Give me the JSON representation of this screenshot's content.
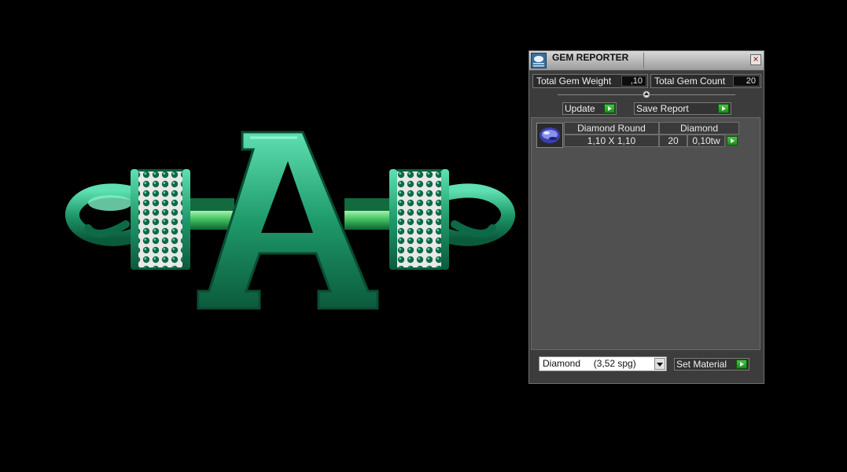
{
  "panel": {
    "title": "GEM REPORTER",
    "close_label": "×",
    "total_weight": {
      "label": "Total Gem Weight",
      "value": ",10"
    },
    "total_count": {
      "label": "Total Gem Count",
      "value": "20"
    },
    "update_label": "Update",
    "save_report_label": "Save Report",
    "gems": [
      {
        "name": "Diamond Round",
        "size": "1,10 X 1,10",
        "material": "Diamond",
        "count": "20",
        "weight": "0,10tw"
      }
    ],
    "material_select": {
      "selected": "Diamond     (3,52 spg)"
    },
    "set_material_label": "Set Material"
  },
  "icons": {
    "app": "gem-reporter-icon",
    "close": "close-icon",
    "collapse": "collapse-arrow-icon",
    "gem": "round-gem-icon"
  },
  "colors": {
    "accent_green": "#2fa82f",
    "ring_green": "#1f9a6b",
    "panel_bg": "#3c3c3c"
  }
}
